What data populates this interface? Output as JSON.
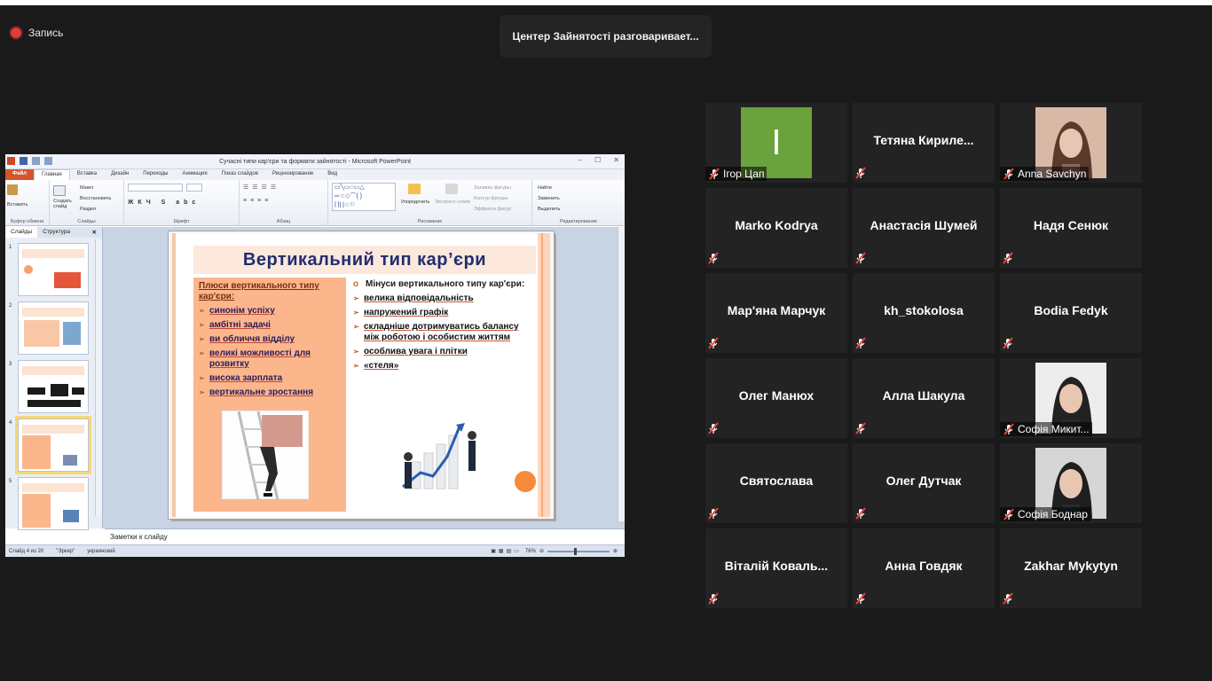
{
  "recording": {
    "label": "Запись"
  },
  "speaker": {
    "text": "Центер Зайнятості разговаривает..."
  },
  "ppt": {
    "window_title": "Сучасні типи кар'єри та формати зайнятості - Microsoft PowerPoint",
    "tabs": [
      "Файл",
      "Главная",
      "Вставка",
      "Дизайн",
      "Переходы",
      "Анимация",
      "Показ слайдов",
      "Рецензирование",
      "Вид"
    ],
    "ribbon": {
      "paste": "Вставить",
      "clipboard": "Буфер обмена",
      "create_slide": "Создать слайд",
      "layout": "Макет",
      "restore": "Восстановить",
      "section": "Раздел",
      "slides": "Слайды",
      "font": "Шрифт",
      "paragraph": "Абзац",
      "arrange": "Упорядочить",
      "express": "Экспресс-стили",
      "fill": "Заливка фигуры",
      "outline": "Контур фигуры",
      "effects": "Эффекты фигур",
      "drawing": "Рисование",
      "find": "Найти",
      "replace": "Заменить",
      "select": "Выделить",
      "editing": "Редактирование"
    },
    "panel_tabs": [
      "Слайды",
      "Структура"
    ],
    "thumbnail_numbers": [
      "1",
      "2",
      "3",
      "4",
      "5"
    ],
    "selected_slide": 4,
    "slide": {
      "title": "Вертикальний тип кар’єри",
      "plus_heading": "Плюси вертикального типу кар'єри:",
      "plus_items": [
        "синонім успіху",
        "амбітні задачі",
        "ви обличчя відділу",
        "великі можливості для розвитку",
        "висока зарплата",
        "вертикальне зростання"
      ],
      "minus_heading": "Мінуси вертикального типу кар'єри:",
      "minus_items": [
        "велика відповідальність",
        "напружений графік",
        "складніше дотримуватись балансу між роботою і особистим життям",
        "особлива увага і плітки",
        "«стеля»"
      ]
    },
    "notes_placeholder": "Заметки к слайду",
    "status": {
      "slide": "Слайд 4 из 20",
      "theme": "\"Эркер\"",
      "lang": "украинский",
      "zoom": "76%"
    }
  },
  "participants": [
    {
      "name": "Ігор Цап",
      "display": "",
      "initial": "I",
      "type": "initial",
      "color": "#6aa23c"
    },
    {
      "name": "",
      "display": "Тетяна  Кириле...",
      "type": "text"
    },
    {
      "name": "Anna Savchyn",
      "display": "",
      "type": "photo"
    },
    {
      "name": "",
      "display": "Marko Kodrya",
      "type": "text"
    },
    {
      "name": "",
      "display": "Анастасія Шумей",
      "type": "text"
    },
    {
      "name": "",
      "display": "Надя Сенюк",
      "type": "text"
    },
    {
      "name": "",
      "display": "Мар'яна Марчук",
      "type": "text"
    },
    {
      "name": "",
      "display": "kh_stokolosa",
      "type": "text"
    },
    {
      "name": "",
      "display": "Bodia Fedyk",
      "type": "text"
    },
    {
      "name": "",
      "display": "Олег Манюх",
      "type": "text"
    },
    {
      "name": "",
      "display": "Алла Шакула",
      "type": "text"
    },
    {
      "name": "Софія Микит...",
      "display": "",
      "type": "photo"
    },
    {
      "name": "",
      "display": "Святослава",
      "type": "text"
    },
    {
      "name": "",
      "display": "Олег Дутчак",
      "type": "text"
    },
    {
      "name": "Софія Боднар",
      "display": "",
      "type": "photo"
    },
    {
      "name": "",
      "display": "Віталій  Коваль...",
      "type": "text"
    },
    {
      "name": "",
      "display": "Анна Говдяк",
      "type": "text"
    },
    {
      "name": "",
      "display": "Zakhar Mykytyn",
      "type": "text"
    }
  ]
}
